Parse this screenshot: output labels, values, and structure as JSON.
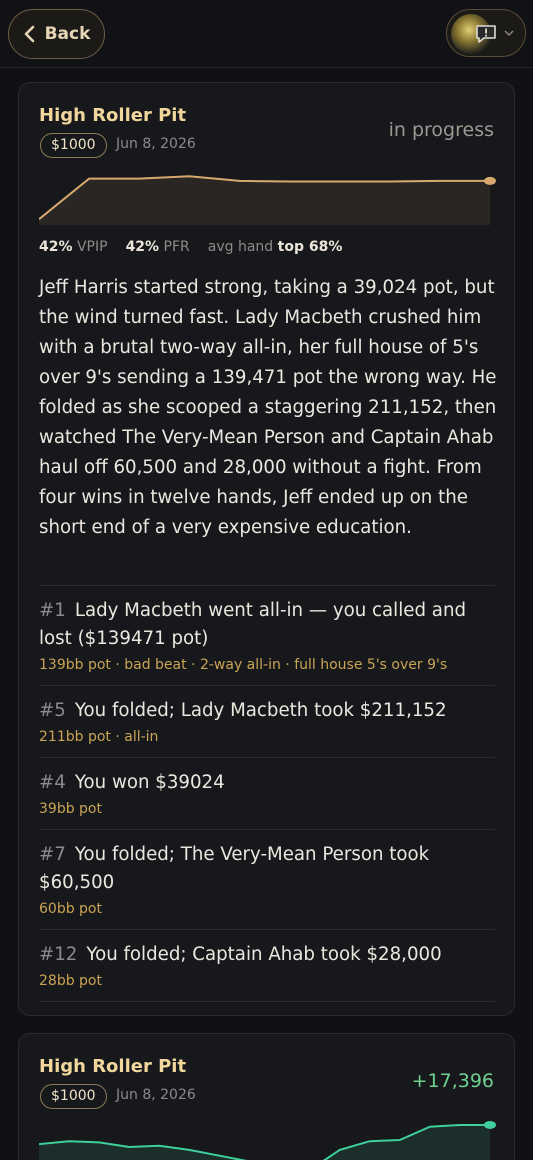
{
  "header": {
    "back_label": "Back"
  },
  "icons": {
    "back": "chevron-left-icon",
    "report": "report-flag-icon",
    "menu": "chevron-down-icon"
  },
  "colors": {
    "accent_gold": "#f1d79b",
    "meta_gold": "#c9a454",
    "positive_green": "#6fd18f",
    "spark_line_1": "#d8a96e",
    "spark_line_2": "#3ecf9a"
  },
  "sessions": [
    {
      "title": "High Roller Pit",
      "stake": "$1000",
      "date": "Jun 8, 2026",
      "status": "in progress",
      "stats": {
        "vpip_value": "42%",
        "vpip_label": "VPIP",
        "pfr_value": "42%",
        "pfr_label": "PFR",
        "avg_label": "avg hand",
        "avg_value": "top 68%"
      },
      "summary": "Jeff Harris started strong, taking a 39,024 pot, but the wind turned fast. Lady Macbeth crushed him with a brutal two-way all-in, her full house of 5's over 9's sending a 139,471 pot the wrong way. He folded as she scooped a staggering 211,152, then watched The Very-Mean Person and Captain Ahab haul off 60,500 and 28,000 without a fight. From four wins in twelve hands, Jeff ended up on the short end of a very expensive education.",
      "hands": [
        {
          "num": "#1",
          "text": "Lady Macbeth went all-in — you called and lost ($139471 pot)",
          "meta": "139bb pot · bad beat · 2-way all-in · full house 5's over 9's"
        },
        {
          "num": "#5",
          "text": "You folded; Lady Macbeth took $211,152",
          "meta": "211bb pot · all-in"
        },
        {
          "num": "#4",
          "text": "You won $39024",
          "meta": "39bb pot"
        },
        {
          "num": "#7",
          "text": "You folded; The Very-Mean Person took $60,500",
          "meta": "60bb pot"
        },
        {
          "num": "#12",
          "text": "You folded; Captain Ahab took $28,000",
          "meta": "28bb pot"
        }
      ],
      "sparkline": [
        0.1,
        0.8,
        0.8,
        0.84,
        0.76,
        0.75,
        0.75,
        0.75,
        0.76,
        0.76
      ]
    },
    {
      "title": "High Roller Pit",
      "stake": "$1000",
      "date": "Jun 8, 2026",
      "status": "+17,396",
      "sparkline": [
        0.55,
        0.6,
        0.58,
        0.5,
        0.52,
        0.45,
        0.35,
        0.25,
        0.15,
        0.1,
        0.45,
        0.6,
        0.62,
        0.85,
        0.88,
        0.88
      ]
    }
  ]
}
